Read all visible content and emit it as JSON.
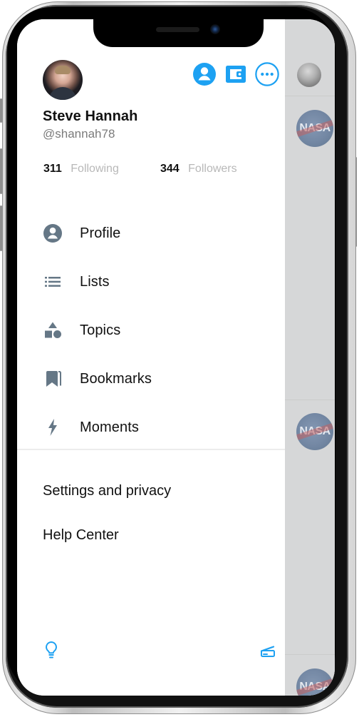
{
  "user": {
    "display_name": "Steve Hannah",
    "handle": "@shannah78",
    "following_count": "311",
    "following_label": "Following",
    "followers_count": "344",
    "followers_label": "Followers"
  },
  "menu": {
    "items": [
      {
        "label": "Profile",
        "icon": "profile-icon"
      },
      {
        "label": "Lists",
        "icon": "lists-icon"
      },
      {
        "label": "Topics",
        "icon": "topics-icon"
      },
      {
        "label": "Bookmarks",
        "icon": "bookmarks-icon"
      },
      {
        "label": "Moments",
        "icon": "moments-icon"
      }
    ]
  },
  "secondary_menu": {
    "items": [
      {
        "label": "Settings and privacy"
      },
      {
        "label": "Help Center"
      }
    ]
  },
  "background_feed": {
    "avatar_labels": [
      "NASA",
      "NASA",
      "NASA"
    ]
  },
  "icons": {
    "account_switch": "account-icon",
    "wallet": "wallet-icon",
    "more": "more-icon",
    "bottom_left": "lightbulb-icon",
    "bottom_right": "scan-icon"
  },
  "colors": {
    "accent": "#1da1f2",
    "text_primary": "#111111",
    "text_secondary": "#7b7b7b",
    "menu_icon": "#657786",
    "overlay": "#d6d7d8"
  }
}
